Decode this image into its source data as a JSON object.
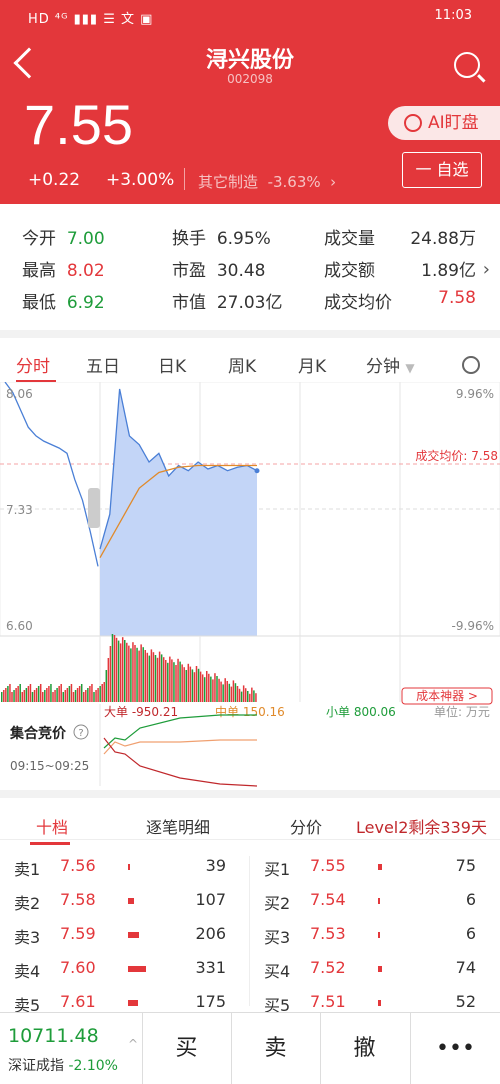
{
  "status_bar": {
    "left": "HD ⁴ᴳ ▮▮▮ ☰ 文 ▣",
    "time": "11:03"
  },
  "header": {
    "title": "浔兴股份",
    "code": "002098"
  },
  "quote": {
    "price": "7.55",
    "change": "+0.22",
    "pct": "+3.00%",
    "sector_name": "其它制造",
    "sector_pct": "-3.63%",
    "ai_label": "AI盯盘",
    "watch_label": "一 自选"
  },
  "stats": {
    "open_label": "今开",
    "open": "7.00",
    "high_label": "最高",
    "high": "8.02",
    "low_label": "最低",
    "low": "6.92",
    "turnover_label": "换手",
    "turnover": "6.95%",
    "pe_label": "市盈",
    "pe": "30.48",
    "mcap_label": "市值",
    "mcap": "27.03亿",
    "vol_label": "成交量",
    "vol": "24.88万",
    "amt_label": "成交额",
    "amt": "1.89亿",
    "avg_label": "成交均价",
    "avg": "7.58"
  },
  "tabs": [
    "分时",
    "五日",
    "日K",
    "周K",
    "月K",
    "分钟"
  ],
  "chart": {
    "y_top": "8.06",
    "y_mid": "7.33",
    "y_bot": "6.60",
    "pct_top": "9.96%",
    "pct_bot": "-9.96%",
    "avg_label": "成交均价: 7.58",
    "cost_btn": "成本神器 >",
    "big": "大单 -950.21",
    "mid": "中单 150.16",
    "small": "小单 800.06",
    "unit": "单位: 万元",
    "auction_label": "集合竞价",
    "auction_time": "09:15~09:25"
  },
  "chart_data": {
    "type": "line",
    "series": [
      {
        "values": [
          8.06,
          8.0,
          7.9,
          7.8,
          7.75,
          7.72,
          7.7,
          7.68,
          7.65,
          7.5,
          7.38,
          7.2,
          7.0
        ]
      },
      {
        "values": [
          7.1,
          7.3,
          8.02,
          7.75,
          7.7,
          7.6,
          7.65,
          7.52,
          7.58,
          7.55,
          7.6,
          7.56,
          7.58,
          7.55,
          7.57,
          7.58,
          7.55
        ]
      }
    ],
    "ylim": [
      6.6,
      8.06
    ]
  },
  "level_tabs": {
    "t1": "十档",
    "t2": "逐笔明细",
    "t3": "分价",
    "t4": "Level2剩余339天"
  },
  "sell": [
    {
      "label": "卖1",
      "price": "7.56",
      "qty": "39"
    },
    {
      "label": "卖2",
      "price": "7.58",
      "qty": "107"
    },
    {
      "label": "卖3",
      "price": "7.59",
      "qty": "206"
    },
    {
      "label": "卖4",
      "price": "7.60",
      "qty": "331"
    },
    {
      "label": "卖5",
      "price": "7.61",
      "qty": "175"
    }
  ],
  "buy": [
    {
      "label": "买1",
      "price": "7.55",
      "qty": "75"
    },
    {
      "label": "买2",
      "price": "7.54",
      "qty": "6"
    },
    {
      "label": "买3",
      "price": "7.53",
      "qty": "6"
    },
    {
      "label": "买4",
      "price": "7.52",
      "qty": "74"
    },
    {
      "label": "买5",
      "price": "7.51",
      "qty": "52"
    }
  ],
  "bottom": {
    "index_value": "10711.48",
    "index_name": "深证成指",
    "index_pct": "-2.10%",
    "buy": "买",
    "sell": "卖",
    "cancel": "撤",
    "more": "•••"
  }
}
